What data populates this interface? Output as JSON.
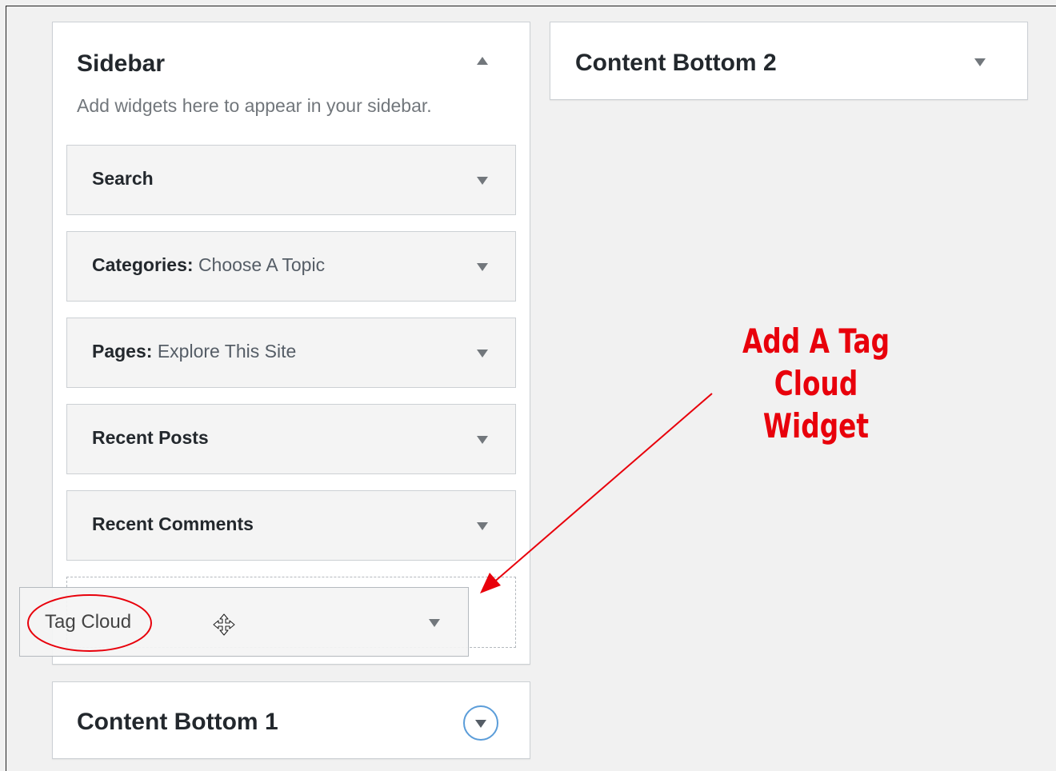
{
  "sidebar": {
    "title": "Sidebar",
    "description": "Add widgets here to appear in your sidebar.",
    "widgets": [
      {
        "label": "Search",
        "subtitle": ""
      },
      {
        "label": "Categories:",
        "subtitle": "Choose A Topic"
      },
      {
        "label": "Pages:",
        "subtitle": "Explore This Site"
      },
      {
        "label": "Recent Posts",
        "subtitle": ""
      },
      {
        "label": "Recent Comments",
        "subtitle": ""
      }
    ]
  },
  "dragged_widget": {
    "label": "Tag Cloud"
  },
  "content_bottom_1": {
    "title": "Content Bottom 1"
  },
  "content_bottom_2": {
    "title": "Content Bottom 2"
  },
  "annotation": {
    "line1": "Add A Tag",
    "line2": "Cloud Widget"
  },
  "colors": {
    "annotation": "#e8000b",
    "focus_ring": "#5b9dd9"
  },
  "icons": [
    "arrow-up-icon",
    "arrow-down-icon",
    "move-cursor-icon"
  ]
}
